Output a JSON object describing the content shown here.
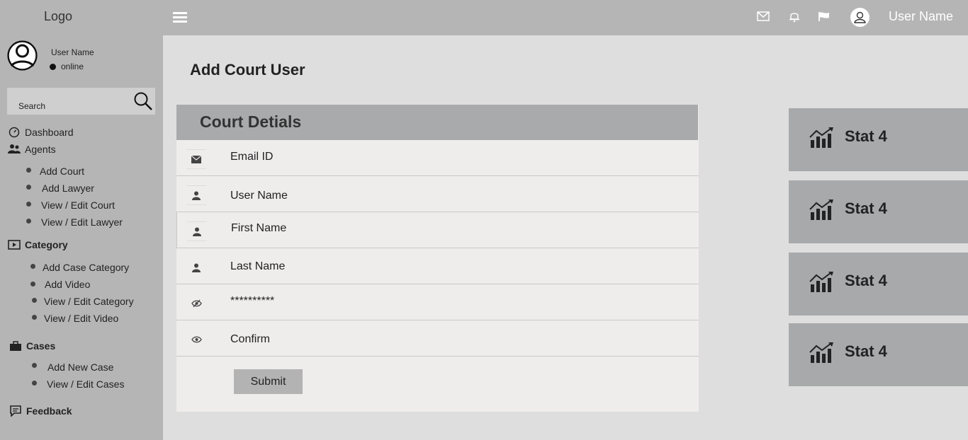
{
  "sidebar": {
    "logo": "Logo",
    "profile": {
      "name": "User Name",
      "status": "online"
    },
    "search": {
      "placeholder": "Search"
    },
    "nav": {
      "dashboard": "Dashboard",
      "agents": "Agents",
      "agents_items": [
        "Add Court",
        "Add Lawyer",
        "View / Edit Court",
        "View / Edit Lawyer"
      ],
      "category": "Category",
      "category_items": [
        "Add Case Category",
        "Add Video",
        "View / Edit Category",
        "View / Edit Video"
      ],
      "cases": "Cases",
      "cases_items": [
        "Add New Case",
        "View / Edit Cases"
      ],
      "feedback": "Feedback"
    }
  },
  "topbar": {
    "icons": [
      "mail-icon",
      "bell-icon",
      "flag-icon",
      "user-icon"
    ],
    "username": "User Name"
  },
  "main": {
    "page_title": "Add Court User",
    "form": {
      "header": "Court Detials",
      "fields": [
        {
          "placeholder": "Email ID",
          "icon": "envelope-icon"
        },
        {
          "placeholder": "User Name",
          "icon": "user-icon"
        },
        {
          "placeholder": "First Name",
          "icon": "user-icon"
        },
        {
          "placeholder": "Last Name",
          "icon": "user-icon"
        },
        {
          "placeholder": "**********",
          "icon": "eye-slash-icon"
        },
        {
          "placeholder": "Confirm",
          "icon": "eye-icon"
        }
      ],
      "submit_label": "Submit"
    },
    "stats": [
      {
        "label": "Stat 4",
        "icon": "bar-chart-icon"
      },
      {
        "label": "Stat 4",
        "icon": "bar-chart-icon"
      },
      {
        "label": "Stat 4",
        "icon": "bar-chart-icon"
      },
      {
        "label": "Stat 4",
        "icon": "bar-chart-icon"
      }
    ]
  },
  "colors": {
    "sidebar_bg": "#b5b5b5",
    "content_bg": "#dedede",
    "form_bg": "#efecec",
    "form_header_bg": "#a9aaab",
    "stat_bg": "#a8a9ab"
  }
}
